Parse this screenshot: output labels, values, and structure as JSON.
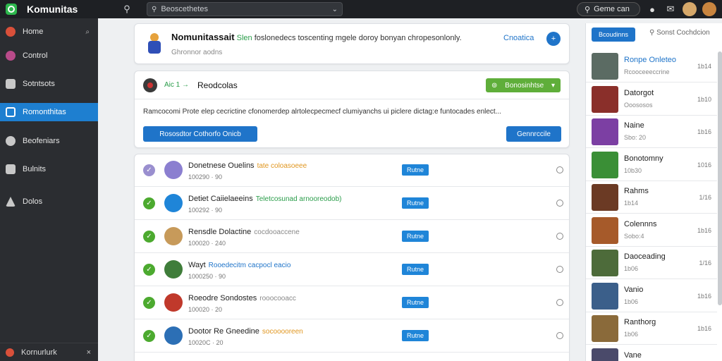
{
  "topbar": {
    "app_title": "Komunitas",
    "search_value": "Beoscethetes",
    "pill_search_label": "Geme can",
    "icons": [
      "search-icon",
      "chevron-down-icon",
      "globe-icon",
      "chat-icon",
      "avatar",
      "avatar"
    ]
  },
  "sidebar": {
    "items": [
      {
        "label": "Home",
        "trail": "⌕",
        "icon": "home-icon",
        "color": "#d9503a"
      },
      {
        "label": "Control",
        "icon": "control-icon",
        "color": "#b94b8a"
      },
      {
        "label": "Sotntsots",
        "icon": "briefcase-icon",
        "color": "#c8c8c8"
      },
      {
        "label": "Romonthitas",
        "icon": "community-icon",
        "color": "#ffffff",
        "active": true
      },
      {
        "label": "Beofeniars",
        "icon": "palette-icon",
        "color": "#c8c8c8"
      },
      {
        "label": "Bulnits",
        "icon": "calendar-icon",
        "color": "#c8c8c8"
      },
      {
        "label": "Dolos",
        "icon": "people-icon",
        "color": "#c8c8c8"
      }
    ],
    "footer_label": "Kornurlurk",
    "footer_close": "×"
  },
  "announcement": {
    "title": "Nomunitassait",
    "highlight": "Slen",
    "text": "foslonedecs toscenting mgele doroy bonyan chropesonlonly.",
    "subtext": "Ghronnor aodns",
    "link": "Cnoatica",
    "plus": "+"
  },
  "compose": {
    "tag": "Aic 1 →",
    "title": "Reodcolas",
    "green_button": "Bonosinhtse",
    "description": "Ramcocomi Prote elep cecrictine cfonomerdep alrtolecpecmecf clumiyanchs ui piclere dictag:e funtocades enlect...",
    "button_left": "Rososdtor Cothorfo Onicb",
    "button_right": "Gennrccile"
  },
  "feed": {
    "button_label": "Rutne",
    "rows": [
      {
        "name": "Donetnese Ouelins",
        "sub": "tate coloasoeee",
        "sub_color": "#e0961f",
        "meta": "100290 · 90",
        "check": "grey",
        "avatar": "#8b7fd0"
      },
      {
        "name": "Detiet Caiielaeeins",
        "sub": "Teletcosunad arnooreodob)",
        "sub_color": "#2a9d4a",
        "meta": "100292 · 90",
        "check": "green",
        "avatar": "#1f85d8"
      },
      {
        "name": "Rensdle Dolactine",
        "sub": "cocdooaccene",
        "sub_color": "#888888",
        "meta": "100020 · 240",
        "check": "green",
        "avatar": "#c79a5a"
      },
      {
        "name": "Wayt",
        "sub": "Rooedecitm   cacpocl eacio",
        "sub_color": "#1f74c9",
        "meta": "1000250 · 90",
        "check": "green",
        "avatar": "#3f7d3a"
      },
      {
        "name": "Roeodre Sondostes",
        "sub": "rooocooacc",
        "sub_color": "#888888",
        "meta": "100020 · 20",
        "check": "green",
        "avatar": "#c0392b"
      },
      {
        "name": "Dootor Re Gneedine",
        "sub": "socooooreen",
        "sub_color": "#e0961f",
        "meta": "10020C · 20",
        "check": "green",
        "avatar": "#2c6fb5"
      }
    ]
  },
  "right_panel": {
    "button": "Bcoudinns",
    "search": "Sonst Cochdcion",
    "items": [
      {
        "title": "Ronpe Onleteo",
        "sub": "Rcooceeeccrine",
        "count": "1b14",
        "color": "#5b6b63",
        "highlight": true
      },
      {
        "title": "Datorgot",
        "sub": "Ooososos",
        "count": "1b10",
        "color": "#8a2f2a"
      },
      {
        "title": "Naine",
        "sub": "Sbo: 20",
        "count": "1b16",
        "color": "#7c3fa3"
      },
      {
        "title": "Bonotomny",
        "sub": "10b30",
        "count": "1016",
        "color": "#3a8f36"
      },
      {
        "title": "Rahms",
        "sub": "1b14",
        "count": "1/16",
        "color": "#6b3a24"
      },
      {
        "title": "Colennns",
        "sub": "Sobo:4",
        "count": "1b16",
        "color": "#a65a2a"
      },
      {
        "title": "Daoceading",
        "sub": "1b06",
        "count": "1/16",
        "color": "#4d6b3a"
      },
      {
        "title": "Vanio",
        "sub": "1b06",
        "count": "1b16",
        "color": "#3b5f8a"
      },
      {
        "title": "Ranthorg",
        "sub": "1b06",
        "count": "1b16",
        "color": "#8a6a3a"
      },
      {
        "title": "Vane",
        "sub": "",
        "count": "",
        "color": "#4a4a6a"
      }
    ]
  }
}
